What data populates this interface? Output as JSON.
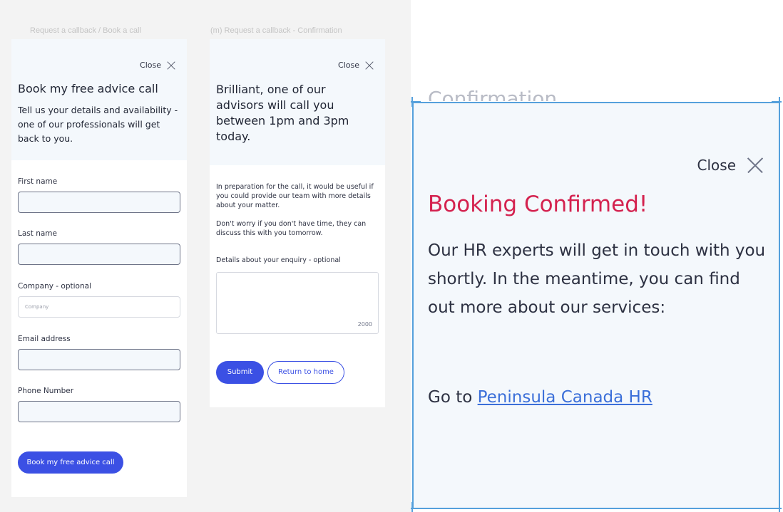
{
  "frames": {
    "left_label": "Request a callback / Book a call",
    "middle_label": "(m) Request a callback - Confirmation"
  },
  "booking_form": {
    "close_label": "Close",
    "close_icon": "close-icon",
    "title": "Book my free advice call",
    "subtitle": "Tell us your details and availability - one of our professionals will get back to you.",
    "fields": [
      {
        "label": "First name",
        "value": "",
        "placeholder": ""
      },
      {
        "label": "Last name",
        "value": "",
        "placeholder": ""
      },
      {
        "label": "Company - optional",
        "value": "",
        "placeholder": "Company"
      },
      {
        "label": "Email address",
        "value": "",
        "placeholder": ""
      },
      {
        "label": "Phone Number",
        "value": "",
        "placeholder": ""
      }
    ],
    "submit_label": "Book my free advice call"
  },
  "confirmation": {
    "close_label": "Close",
    "title": "Brilliant, one of our advisors will call you between 1pm and 3pm today.",
    "text1": "In preparation for the call, it would be useful if you could provide our team with more details about your matter.",
    "text2": "Don't worry if you don't have time, they can discuss this with you tomorrow.",
    "details_label": "Details about your enquiry - optional",
    "details_value": "",
    "char_counter": "2000",
    "submit_label": "Submit",
    "return_label": "Return to home"
  },
  "zoomed": {
    "close_label": "Close",
    "title": "Booking Confirmed!",
    "body": "Our HR experts will get in touch with you shortly. In the meantime, you can find out more about our services:",
    "goto_prefix": "Go to ",
    "link_label": "Peninsula Canada HR"
  },
  "colors": {
    "accent": "#3b50e4",
    "confirmed_title": "#d4224f",
    "selection": "#55a0dc",
    "panel_head": "#f4f8fc"
  }
}
